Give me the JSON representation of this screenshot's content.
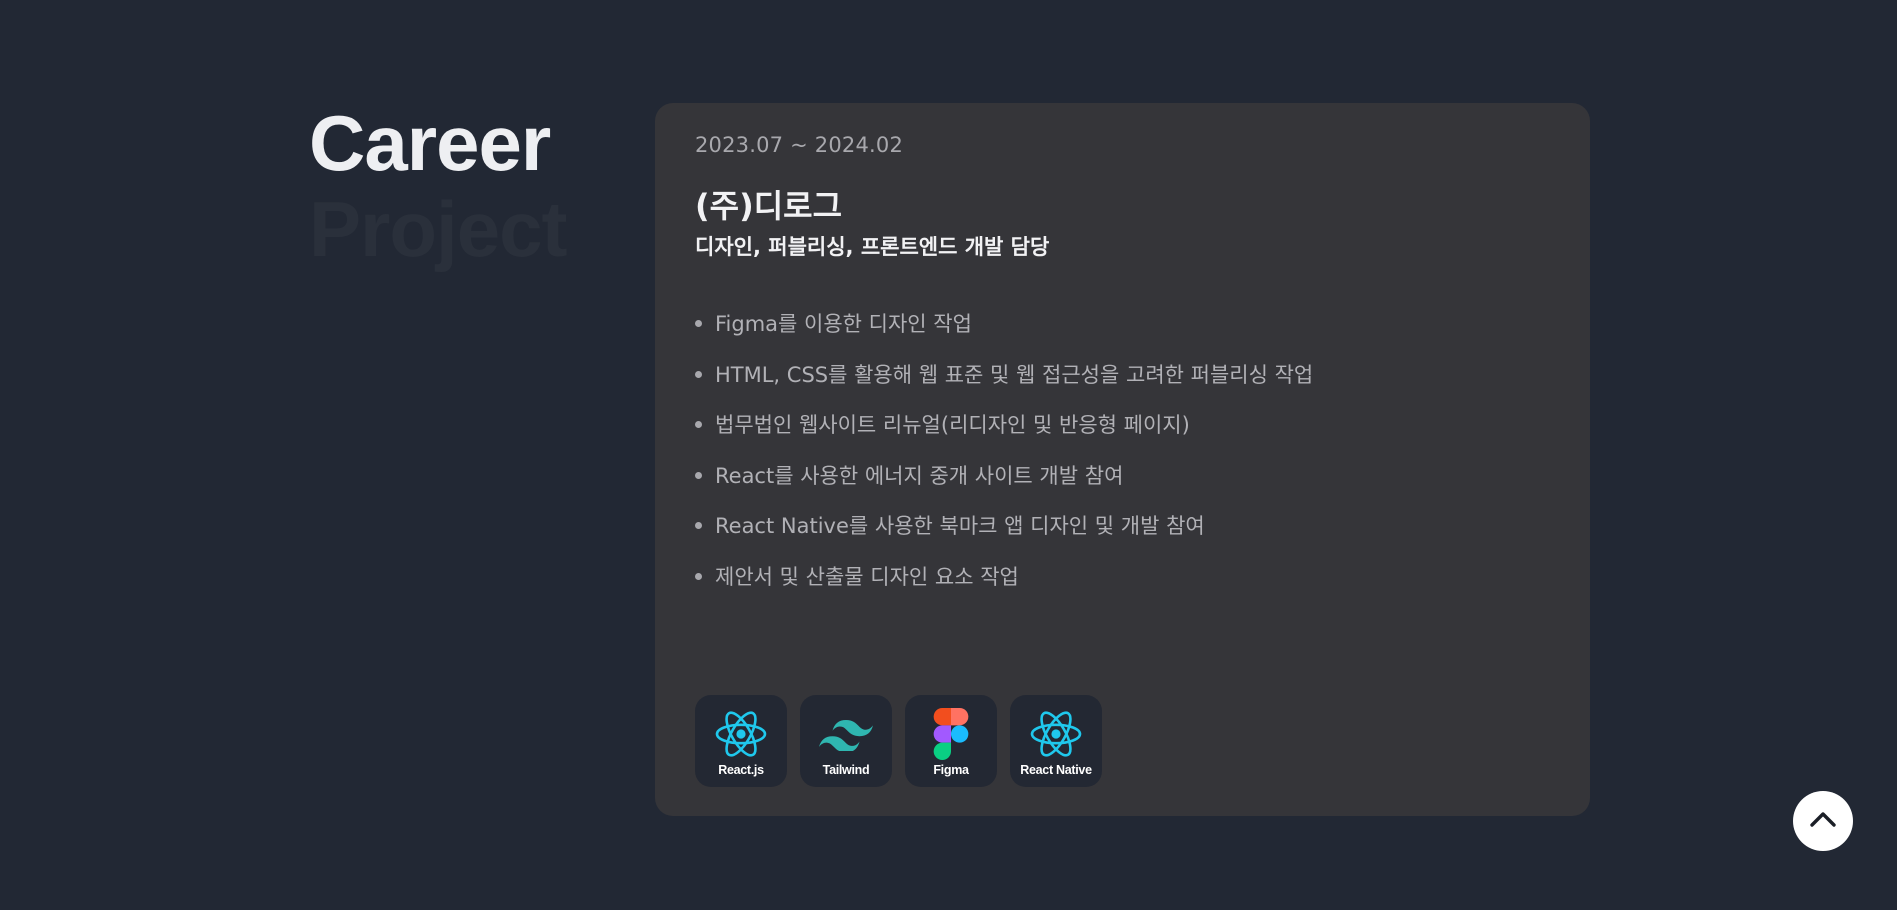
{
  "nav": {
    "items": [
      {
        "label": "Career",
        "active": true
      },
      {
        "label": "Project",
        "active": false
      }
    ]
  },
  "career": {
    "period": "2023.07 ~ 2024.02",
    "company": "(주)디로그",
    "role": "디자인, 퍼블리싱, 프론트엔드 개발 담당",
    "duties": [
      "Figma를 이용한 디자인 작업",
      "HTML, CSS를 활용해 웹 표준 및 웹 접근성을 고려한 퍼블리싱 작업",
      "법무법인 웹사이트 리뉴얼(리디자인 및 반응형 페이지)",
      "React를 사용한 에너지 중개 사이트 개발 참여",
      "React Native를 사용한 북마크 앱 디자인 및 개발 참여",
      "제안서 및 산출물 디자인 요소 작업"
    ],
    "skills": [
      {
        "name": "React.js",
        "icon": "react-icon"
      },
      {
        "name": "Tailwind",
        "icon": "tailwind-icon"
      },
      {
        "name": "Figma",
        "icon": "figma-icon"
      },
      {
        "name": "React Native",
        "icon": "react-native-icon"
      }
    ]
  },
  "scroll_top": {
    "icon": "chevron-up-icon"
  },
  "colors": {
    "background": "#222834",
    "card": "#353539",
    "skill_tile": "#232833",
    "react": "#1fc8ed",
    "tailwind": "#2fb6b0"
  }
}
